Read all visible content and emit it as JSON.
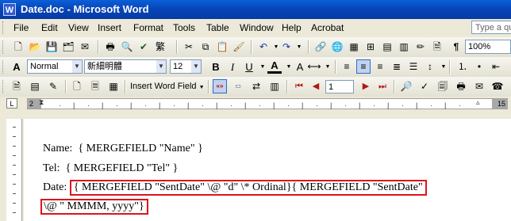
{
  "window": {
    "title": "Date.doc - Microsoft Word",
    "app_icon": "W"
  },
  "menu": {
    "items": [
      "File",
      "Edit",
      "View",
      "Insert",
      "Format",
      "Tools",
      "Table",
      "Window",
      "Help",
      "Acrobat"
    ],
    "ask_placeholder": "Type a qu"
  },
  "standard_toolbar": {
    "zoom": "100%"
  },
  "formatting_toolbar": {
    "style": "Normal",
    "font": "新細明體",
    "size": "12"
  },
  "mailmerge_toolbar": {
    "insert_word_field": "Insert Word Field",
    "record_number": "1"
  },
  "ruler": {
    "left_number": "2",
    "right_number": "15"
  },
  "document": {
    "line1_label": "Name:",
    "line1_field": "{ MERGEFIELD \"Name\" }",
    "line2_label": "Tel:",
    "line2_field": "{ MERGEFIELD \"Tel\" }",
    "line3_label": "Date:",
    "line3_field": "{ MERGEFIELD \"SentDate\" \\@ \"d\" \\* Ordinal}{ MERGEFIELD \"SentDate\"",
    "line4_field": "\\@ \" MMMM, yyyy\"}"
  },
  "colors": {
    "title_bar": "#0846b8",
    "highlight_border": "#e0131a",
    "chrome": "#ece9d8"
  }
}
